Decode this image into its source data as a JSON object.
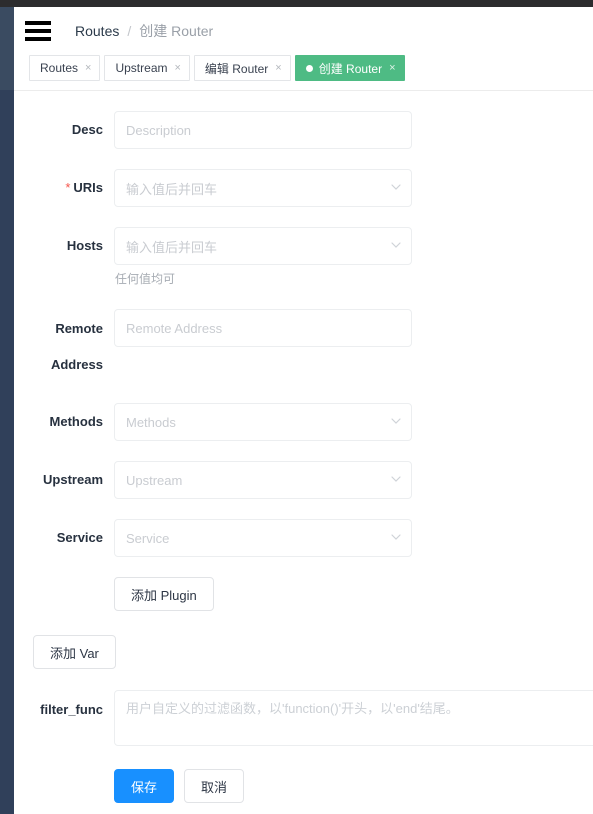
{
  "window": {
    "top_strip_color": "#2c2c2e",
    "sidebar_color": "#3a4b61"
  },
  "header": {
    "menu_icon": "hamburger-icon",
    "breadcrumb": {
      "root": "Routes",
      "separator": "/",
      "current": "创建 Router"
    }
  },
  "tabs": {
    "active_color": "#4ebb84",
    "items": [
      {
        "label": "Routes",
        "close": "×",
        "active": false,
        "dot": false
      },
      {
        "label": "Upstream",
        "close": "×",
        "active": false,
        "dot": false
      },
      {
        "label": "编辑 Router",
        "close": "×",
        "active": false,
        "dot": false
      },
      {
        "label": "创建 Router",
        "close": "×",
        "active": true,
        "dot": true
      }
    ]
  },
  "form": {
    "fields": {
      "desc": {
        "label": "Desc",
        "placeholder": "Description",
        "value": "",
        "required": false
      },
      "uris": {
        "label": "URIs",
        "placeholder": "输入值后并回车",
        "value": "",
        "required": true,
        "required_mark": "*"
      },
      "hosts": {
        "label": "Hosts",
        "placeholder": "输入值后并回车",
        "value": "",
        "required": false,
        "help": "任何值均可"
      },
      "remote_address": {
        "label": "Remote Address",
        "placeholder": "Remote Address",
        "value": "",
        "required": false
      },
      "methods": {
        "label": "Methods",
        "placeholder": "Methods",
        "value": "",
        "required": false
      },
      "upstream": {
        "label": "Upstream",
        "placeholder": "Upstream",
        "value": "",
        "required": false
      },
      "service": {
        "label": "Service",
        "placeholder": "Service",
        "value": "",
        "required": false
      },
      "filter_func": {
        "label": "filter_func",
        "placeholder": "用户自定义的过滤函数，以'function()'开头，以'end'结尾。",
        "value": ""
      }
    },
    "add_plugin_button": "添加 Plugin",
    "add_var_button": "添加 Var",
    "save_button": "保存",
    "cancel_button": "取消",
    "save_button_color": "#1890ff"
  }
}
